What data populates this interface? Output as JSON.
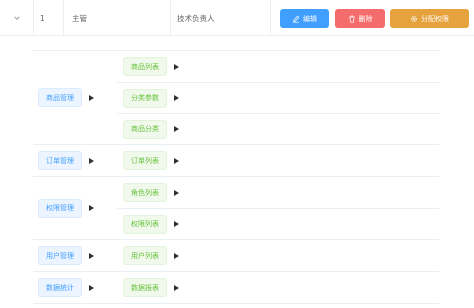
{
  "row": {
    "index": "1",
    "role_name": "主管",
    "role_desc": "技术负责人",
    "actions": {
      "edit_label": "编辑",
      "delete_label": "删除",
      "assign_label": "分配权限"
    }
  },
  "permissions": [
    {
      "label": "商品管理",
      "children": [
        "商品列表",
        "分类参数",
        "商品分类"
      ]
    },
    {
      "label": "订单管理",
      "children": [
        "订单列表"
      ]
    },
    {
      "label": "权限管理",
      "children": [
        "角色列表",
        "权限列表"
      ]
    },
    {
      "label": "用户管理",
      "children": [
        "用户列表"
      ]
    },
    {
      "label": "数据统计",
      "children": [
        "数据报表"
      ]
    }
  ],
  "colors": {
    "primary": "#409eff",
    "danger": "#f56c6c",
    "warning": "#e6a23c",
    "success": "#67c23a"
  },
  "icons": {
    "expand": "chevron-down-icon",
    "edit": "edit-icon",
    "delete": "trash-icon",
    "assign": "gear-icon",
    "caret": "caret-right-icon"
  }
}
